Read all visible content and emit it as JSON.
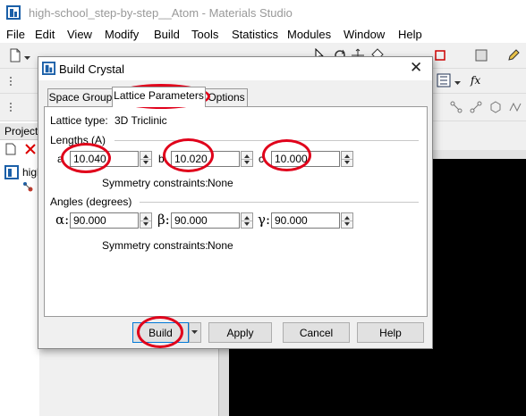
{
  "app": {
    "title": "high-school_step-by-step__Atom - Materials Studio",
    "menu": [
      "File",
      "Edit",
      "View",
      "Modify",
      "Build",
      "Tools",
      "Statistics",
      "Modules",
      "Window",
      "Help"
    ]
  },
  "project_panel": {
    "header": "Project",
    "tree_item": "high"
  },
  "dialog": {
    "title": "Build Crystal",
    "close_glyph": "✕",
    "tabs": [
      "Space Group",
      "Lattice Parameters",
      "Options"
    ],
    "active_tab": "Lattice Parameters",
    "lattice_type_label": "Lattice type:",
    "lattice_type_value": "3D Triclinic",
    "lengths_header": "Lengths (A)",
    "lengths": [
      {
        "label": "a",
        "value": "10.040"
      },
      {
        "label": "b",
        "value": "10.020"
      },
      {
        "label": "c",
        "value": "10.000"
      }
    ],
    "lengths_symmetry_label": "Symmetry constraints:",
    "lengths_symmetry_value": "None",
    "angles_header": "Angles (degrees)",
    "angles": [
      {
        "label": "α:",
        "value": "90.000"
      },
      {
        "label": "β:",
        "value": "90.000"
      },
      {
        "label": "γ:",
        "value": "90.000"
      }
    ],
    "angles_symmetry_label": "Symmetry constraints:",
    "angles_symmetry_value": "None",
    "buttons": {
      "build": "Build",
      "apply": "Apply",
      "cancel": "Cancel",
      "help": "Help"
    }
  },
  "colors": {
    "highlight": "#e0001a",
    "graphics_background": "#000000",
    "focus_border": "#0078d7"
  }
}
